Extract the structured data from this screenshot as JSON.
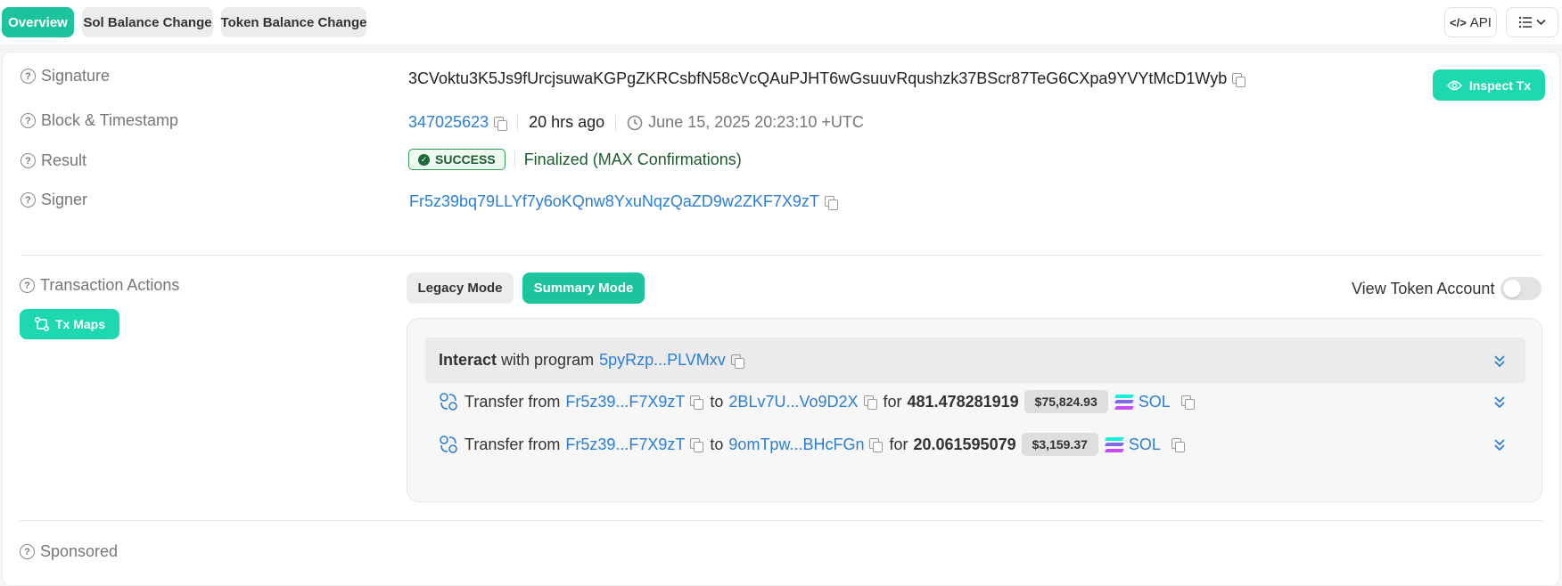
{
  "tabs": [
    {
      "label": "Overview",
      "active": true
    },
    {
      "label": "Sol Balance Change",
      "active": false
    },
    {
      "label": "Token Balance Change",
      "active": false
    }
  ],
  "toolbar": {
    "api_label": "API"
  },
  "rows": {
    "signature": {
      "label": "Signature",
      "value": "3CVoktu3K5Js9fUrcjsuwaKGPgZKRCsbfN58cVcQAuPJHT6wGsuuvRqushzk37BScr87TeG6CXpa9YVYtMcD1Wyb",
      "inspect_label": "Inspect Tx"
    },
    "block": {
      "label": "Block & Timestamp",
      "block": "347025623",
      "age": "20 hrs ago",
      "timestamp": "June 15, 2025 20:23:10 +UTC"
    },
    "result": {
      "label": "Result",
      "status": "SUCCESS",
      "finality": "Finalized (MAX Confirmations)"
    },
    "signer": {
      "label": "Signer",
      "value": "Fr5z39bq79LLYf7y6oKQnw8YxuNqzQaZD9w2ZKF7X9zT"
    }
  },
  "actions": {
    "label": "Transaction Actions",
    "tx_maps_label": "Tx Maps",
    "modes": [
      {
        "label": "Legacy Mode",
        "active": false
      },
      {
        "label": "Summary Mode",
        "active": true
      }
    ],
    "view_token_account_label": "View Token Account",
    "view_token_account_on": false,
    "interact": {
      "bold": "Interact",
      "text": "with program",
      "program": "5pyRzp...PLVMxv"
    },
    "transfers": [
      {
        "prefix": "Transfer from",
        "from": "Fr5z39...F7X9zT",
        "to_word": "to",
        "to": "2BLv7U...Vo9D2X",
        "for_word": "for",
        "amount": "481.478281919",
        "usd": "$75,824.93",
        "token": "SOL"
      },
      {
        "prefix": "Transfer from",
        "from": "Fr5z39...F7X9zT",
        "to_word": "to",
        "to": "9omTpw...BHcFGn",
        "for_word": "for",
        "amount": "20.061595079",
        "usd": "$3,159.37",
        "token": "SOL"
      }
    ]
  },
  "sponsored_label": "Sponsored",
  "colors": {
    "accent": "#1bc49c",
    "link": "#2a7ed6",
    "success": "#2e9f4e"
  }
}
